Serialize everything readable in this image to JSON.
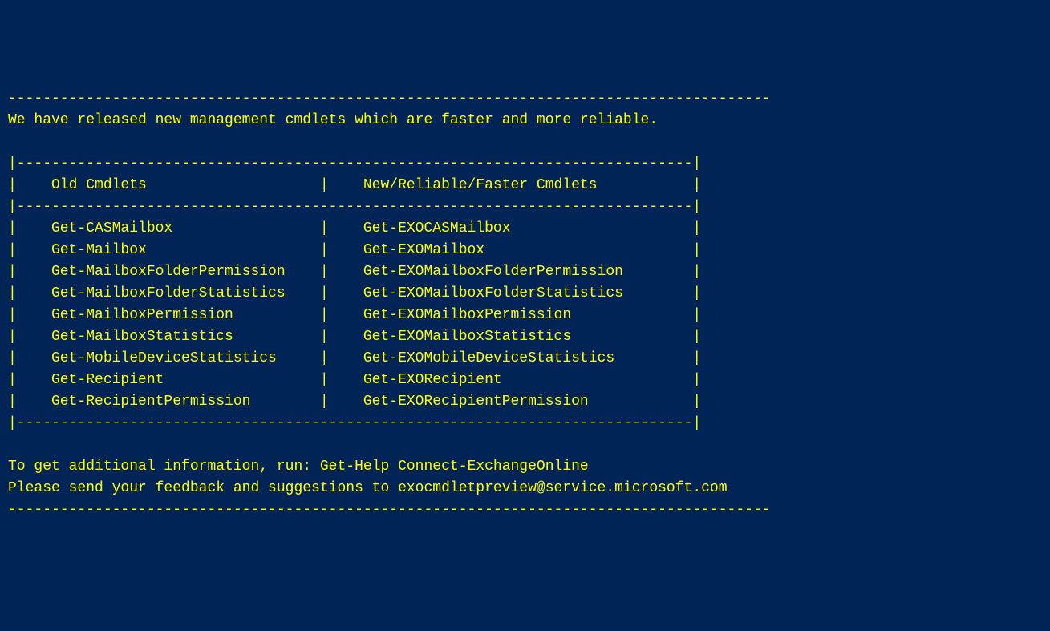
{
  "divider": "----------------------------------------------------------------------------------------",
  "intro": "We have released new management cmdlets which are faster and more reliable.",
  "table_top": "|------------------------------------------------------------------------------|",
  "table_header": "|    Old Cmdlets                    |    New/Reliable/Faster Cmdlets           |",
  "table_sep": "|------------------------------------------------------------------------------|",
  "rows": [
    "|    Get-CASMailbox                 |    Get-EXOCASMailbox                     |",
    "|    Get-Mailbox                    |    Get-EXOMailbox                        |",
    "|    Get-MailboxFolderPermission    |    Get-EXOMailboxFolderPermission        |",
    "|    Get-MailboxFolderStatistics    |    Get-EXOMailboxFolderStatistics        |",
    "|    Get-MailboxPermission          |    Get-EXOMailboxPermission              |",
    "|    Get-MailboxStatistics          |    Get-EXOMailboxStatistics              |",
    "|    Get-MobileDeviceStatistics     |    Get-EXOMobileDeviceStatistics         |",
    "|    Get-Recipient                  |    Get-EXORecipient                      |",
    "|    Get-RecipientPermission        |    Get-EXORecipientPermission            |"
  ],
  "table_bottom": "|------------------------------------------------------------------------------|",
  "help_line": "To get additional information, run: Get-Help Connect-ExchangeOnline",
  "feedback_line": "Please send your feedback and suggestions to exocmdletpreview@service.microsoft.com",
  "divider_bottom": "----------------------------------------------------------------------------------------"
}
